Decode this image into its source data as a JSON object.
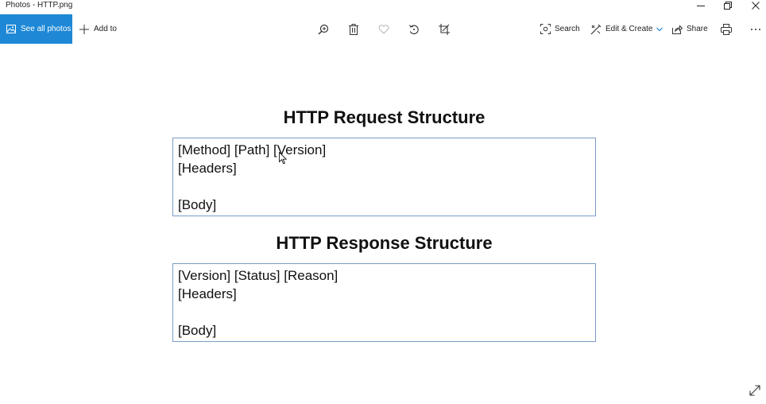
{
  "window": {
    "title": "Photos - HTTP.png"
  },
  "toolbar": {
    "see_all_photos": "See all photos",
    "add_to": "Add to",
    "search": "Search",
    "edit_create": "Edit & Create",
    "share": "Share"
  },
  "image": {
    "request_title": "HTTP Request Structure",
    "request_lines": [
      "[Method] [Path] [Version]",
      "[Headers]",
      "",
      "[Body]"
    ],
    "response_title": "HTTP Response Structure",
    "response_lines": [
      "[Version] [Status] [Reason]",
      "[Headers]",
      "",
      "[Body]"
    ]
  },
  "colors": {
    "accent": "#1e88d6",
    "box_border": "#7a9cc6"
  },
  "icons": [
    "image-icon",
    "plus-icon",
    "zoom-in-icon",
    "delete-icon",
    "heart-icon",
    "rotate-icon",
    "crop-icon",
    "search-icon",
    "edit-create-icon",
    "chevron-down-icon",
    "share-icon",
    "print-icon",
    "more-icon",
    "minimize-icon",
    "restore-icon",
    "close-icon",
    "expand-icon"
  ]
}
